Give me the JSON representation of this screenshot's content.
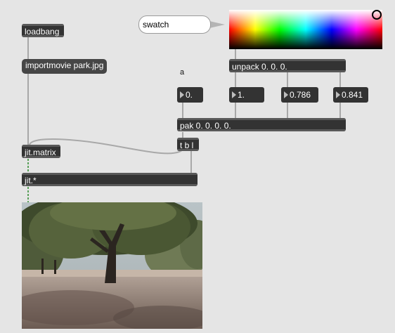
{
  "objects": {
    "loadbang": "loadbang",
    "importmovie": "importmovie park.jpg",
    "jit_matrix": "jit.matrix",
    "jit_mult": "jit.*",
    "unpack": "unpack 0. 0. 0.",
    "pak": "pak 0. 0. 0. 0.",
    "tbl": "t b l"
  },
  "swatch_message": "swatch",
  "comment_a": "a",
  "numbers": {
    "n1": "0.",
    "n2": "1.",
    "n3": "0.786",
    "n4": "0.841"
  },
  "colors": {
    "background": "#e5e5e5",
    "object": "#333333",
    "patchcord": "#a8a8a8",
    "signal_cord": "#5aa05a"
  },
  "icons": {
    "number_arrow": "triangle-right-icon",
    "color_knob": "circle-ring-icon"
  }
}
